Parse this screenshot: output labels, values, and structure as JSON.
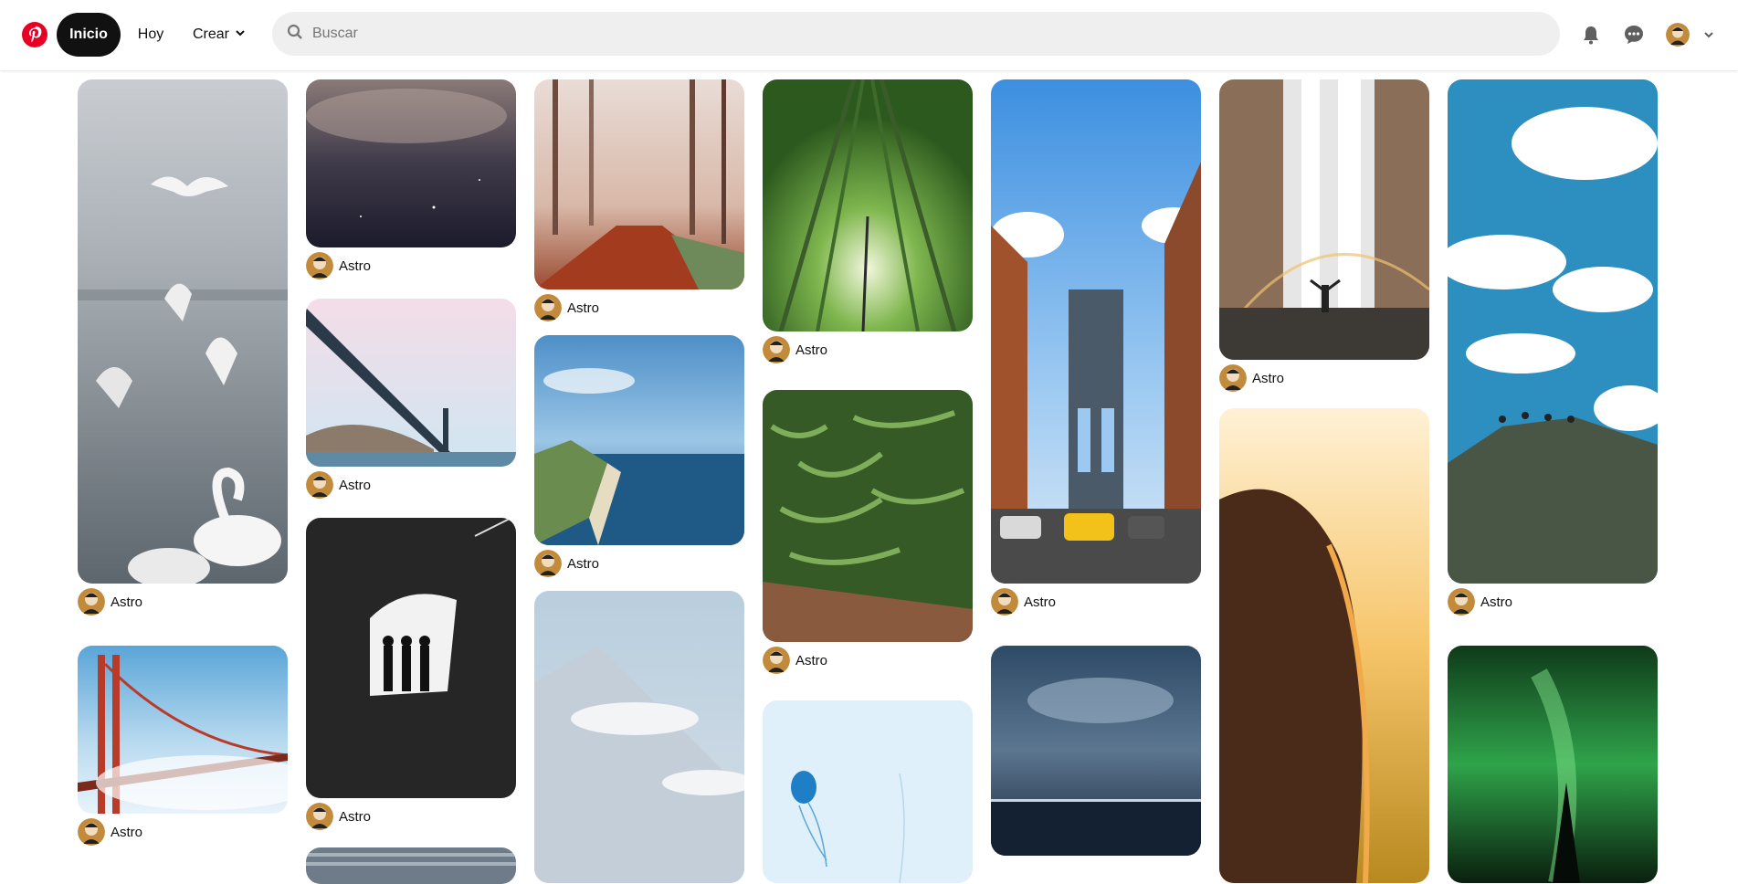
{
  "header": {
    "logo": "pinterest-logo",
    "nav": {
      "home": "Inicio",
      "today": "Hoy",
      "create": "Crear"
    },
    "search_placeholder": "Buscar",
    "icons": [
      "bell-icon",
      "chat-icon",
      "avatar",
      "chevron-down-icon"
    ]
  },
  "colors": {
    "brand": "#e60023",
    "active_nav": "#111111",
    "search_bg": "#efefef"
  },
  "pins": [
    {
      "id": "c1p1",
      "name": "seagulls-swans",
      "author": "Astro"
    },
    {
      "id": "c1p2",
      "name": "golden-gate-fog",
      "author": "Astro"
    },
    {
      "id": "c2p1",
      "name": "night-sky-clouds",
      "author": "Astro"
    },
    {
      "id": "c2p2",
      "name": "golden-gate-from-below",
      "author": "Astro"
    },
    {
      "id": "c2p3",
      "name": "tunnel-silhouettes",
      "author": "Astro"
    },
    {
      "id": "c3p1",
      "name": "foggy-autumn-forest",
      "author": "Astro"
    },
    {
      "id": "c3p2",
      "name": "coastal-cliffs",
      "author": "Astro"
    },
    {
      "id": "c3p3",
      "name": "misty-mountains"
    },
    {
      "id": "c4p1",
      "name": "bamboo-forest",
      "author": "Astro"
    },
    {
      "id": "c4p2",
      "name": "green-beans",
      "author": "Astro"
    },
    {
      "id": "c4p3",
      "name": "blue-jellyfish"
    },
    {
      "id": "c5p1",
      "name": "manhattan-bridge",
      "author": "Astro"
    },
    {
      "id": "c5p2",
      "name": "stormy-ocean-sky"
    },
    {
      "id": "c6p1",
      "name": "waterfall-rainbow",
      "author": "Astro"
    },
    {
      "id": "c6p2",
      "name": "sunset-hair"
    },
    {
      "id": "c7p1",
      "name": "clouds-cliff-people",
      "author": "Astro"
    },
    {
      "id": "c7p2",
      "name": "northern-lights"
    }
  ]
}
